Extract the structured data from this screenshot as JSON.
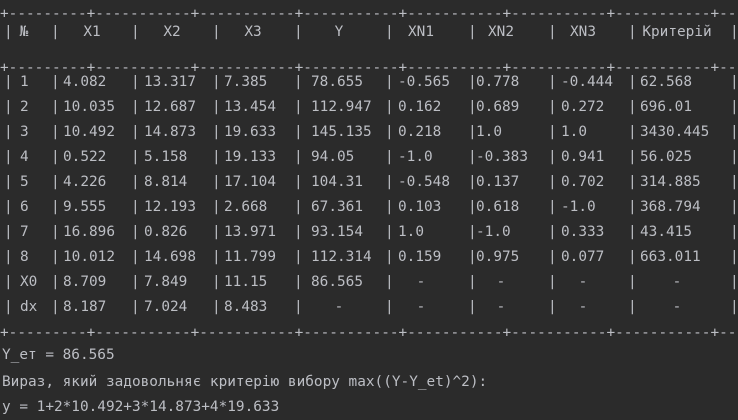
{
  "separator": "+---------+-----------+-----------+-----------+-----------+-----------+-----------+-----------+-----------+",
  "headers": [
    "№",
    "X1",
    "X2",
    "X3",
    "Y",
    "XN1",
    "XN2",
    "XN3",
    "Критерій"
  ],
  "rows": [
    [
      "1",
      "4.082",
      "13.317",
      "7.385",
      "78.655",
      "-0.565",
      "0.778",
      "-0.444",
      "62.568"
    ],
    [
      "2",
      "10.035",
      "12.687",
      "13.454",
      "112.947",
      "0.162",
      "0.689",
      "0.272",
      "696.01"
    ],
    [
      "3",
      "10.492",
      "14.873",
      "19.633",
      "145.135",
      "0.218",
      "1.0",
      "1.0",
      "3430.445"
    ],
    [
      "4",
      "0.522",
      "5.158",
      "19.133",
      "94.05",
      "-1.0",
      "-0.383",
      "0.941",
      "56.025"
    ],
    [
      "5",
      "4.226",
      "8.814",
      "17.104",
      "104.31",
      "-0.548",
      "0.137",
      "0.702",
      "314.885"
    ],
    [
      "6",
      "9.555",
      "12.193",
      "2.668",
      "67.361",
      "0.103",
      "0.618",
      "-1.0",
      "368.794"
    ],
    [
      "7",
      "16.896",
      "0.826",
      "13.971",
      "93.154",
      "1.0",
      "-1.0",
      "0.333",
      "43.415"
    ],
    [
      "8",
      "10.012",
      "14.698",
      "11.799",
      "112.314",
      "0.159",
      "0.975",
      "0.077",
      "663.011"
    ],
    [
      "X0",
      "8.709",
      "7.849",
      "11.15",
      "86.565",
      "-",
      "-",
      "-",
      "-"
    ],
    [
      "dx",
      "8.187",
      "7.024",
      "8.483",
      "-",
      "-",
      "-",
      "-",
      "-"
    ]
  ],
  "output": {
    "y_et_line": "Y_ет = 86.565",
    "criterion_line": "Вираз, який задовольняє критерію вибору max((Y-Y_et)^2):",
    "equation_line": "y = 1+2*10.492+3*14.873+4*19.633"
  }
}
